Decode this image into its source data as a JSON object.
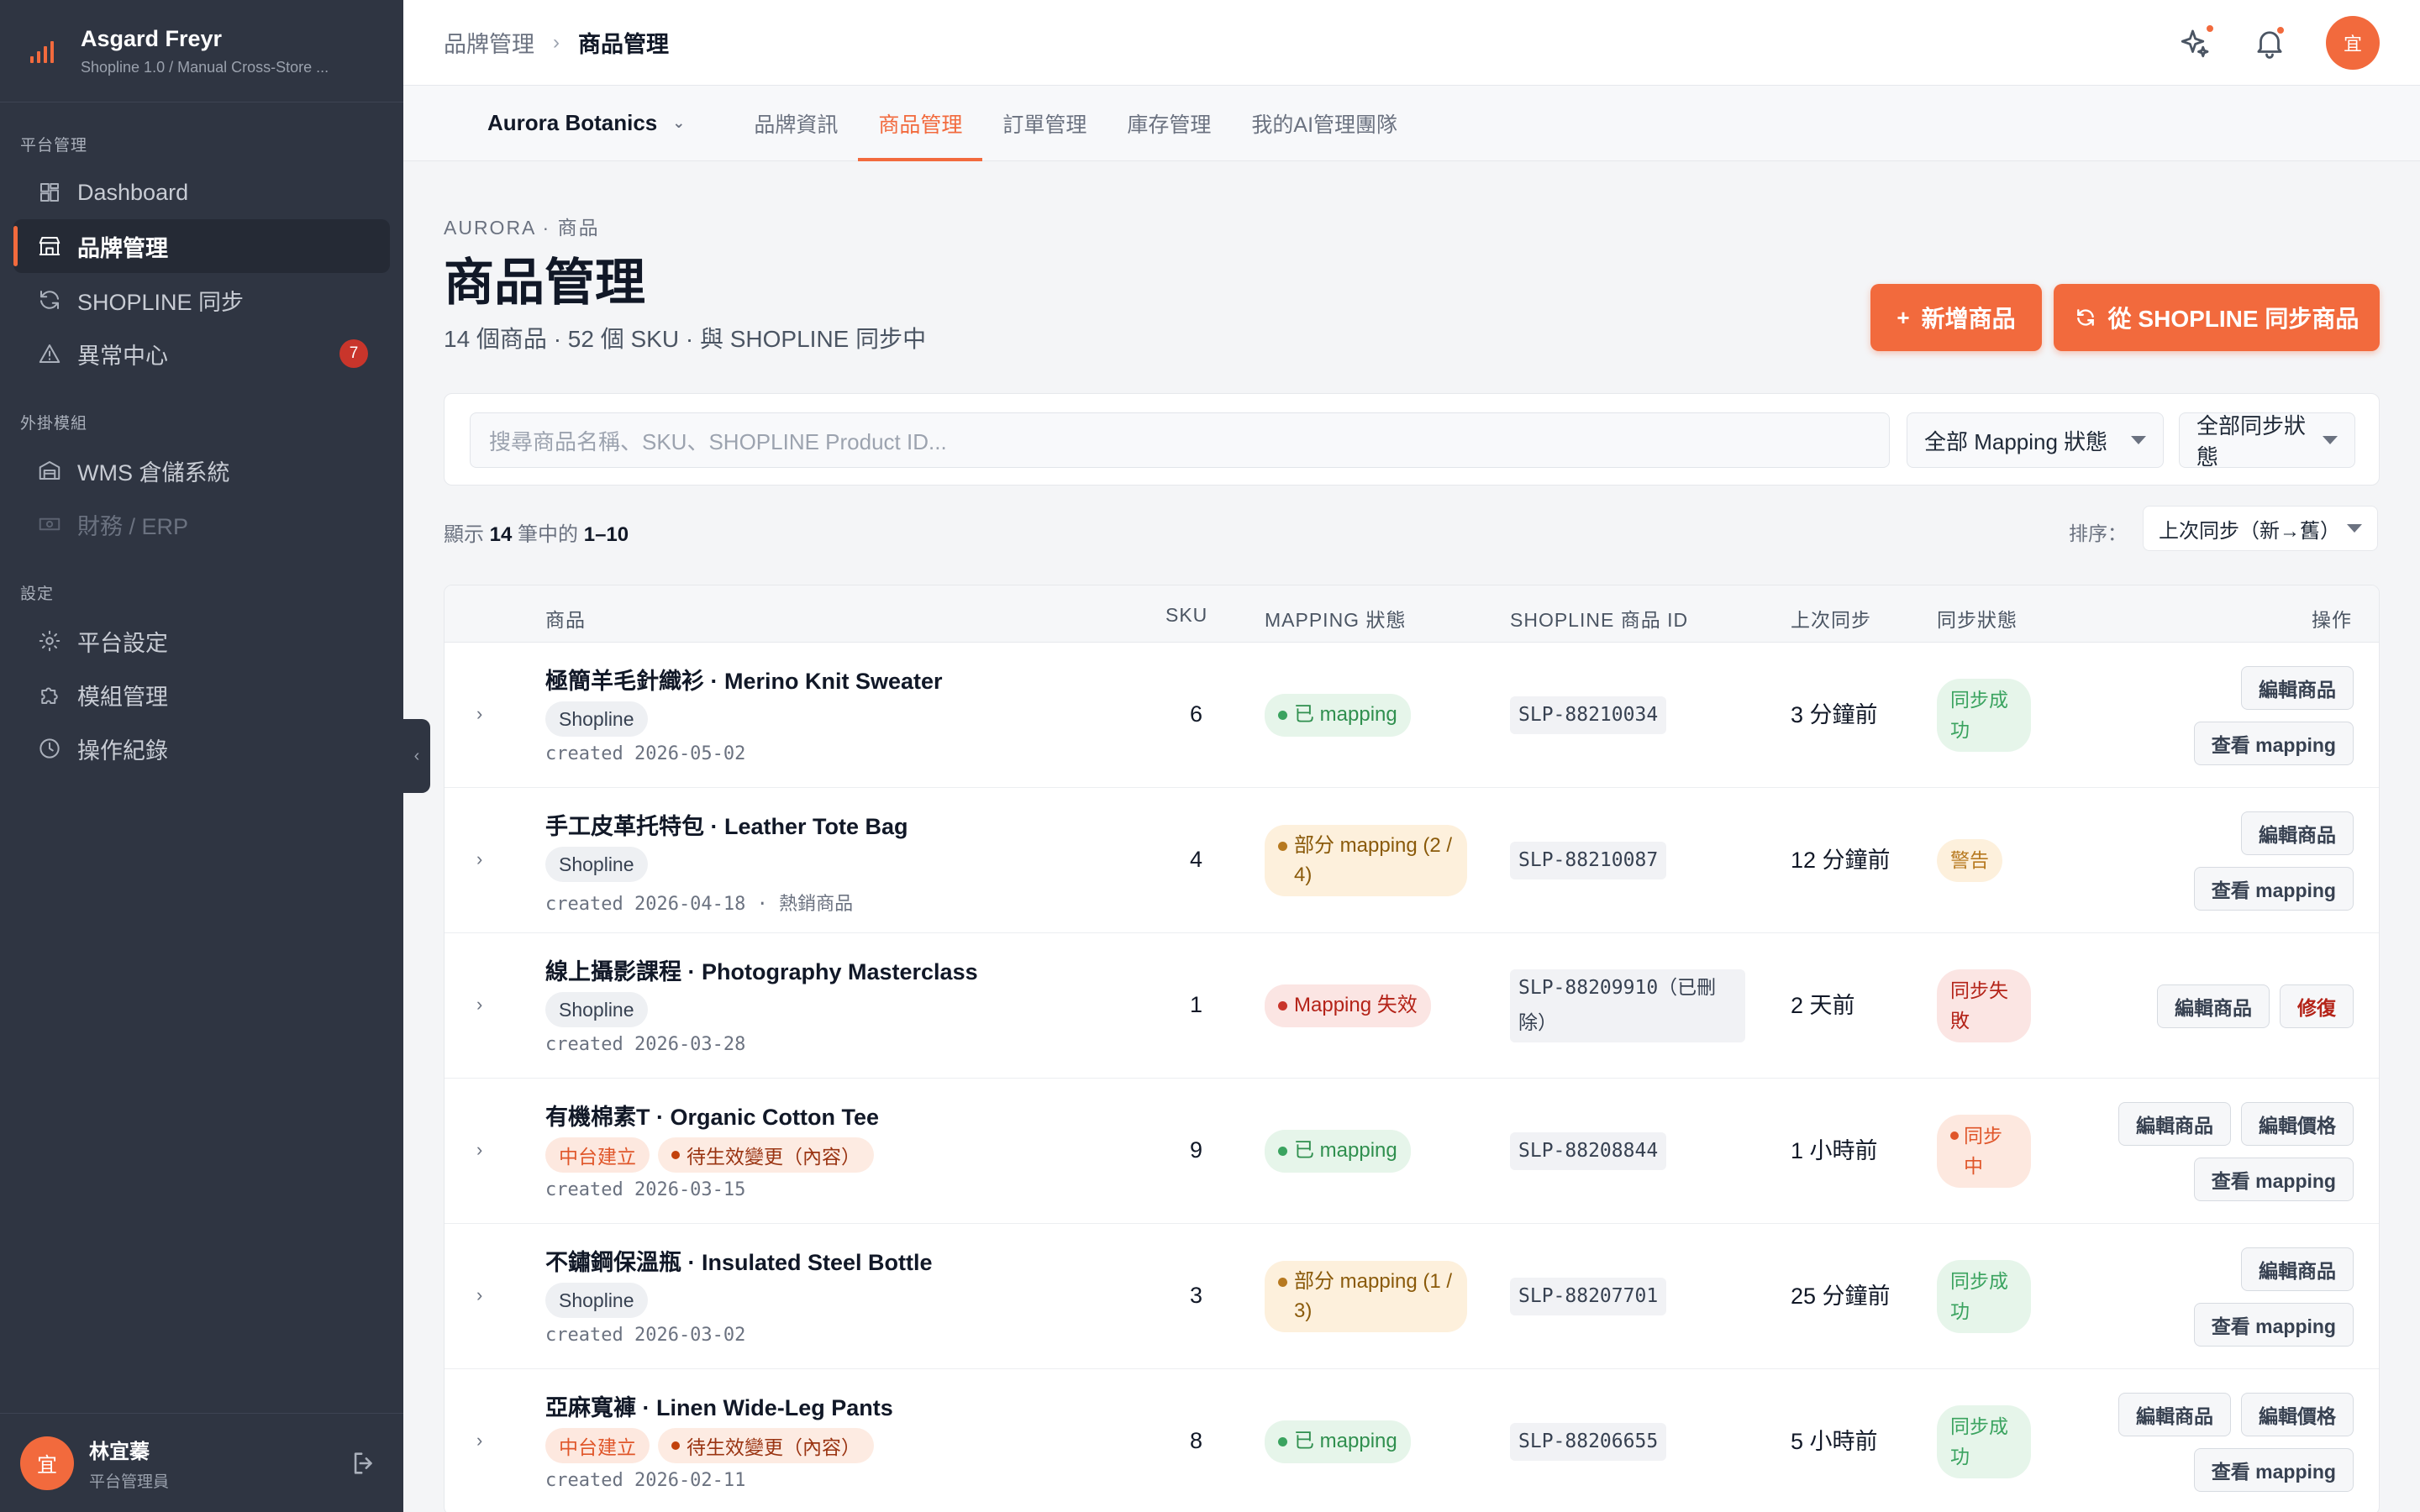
{
  "sidebar": {
    "app_name": "Asgard Freyr",
    "app_sub": "Shopline 1.0 / Manual Cross-Store ...",
    "sections": [
      {
        "title": "平台管理",
        "items": [
          {
            "label": "Dashboard",
            "icon": "dashboard-icon"
          },
          {
            "label": "品牌管理",
            "icon": "store-icon",
            "active": true
          },
          {
            "label": "SHOPLINE 同步",
            "icon": "sync-icon"
          },
          {
            "label": "異常中心",
            "icon": "warning-icon",
            "badge": "7"
          }
        ]
      },
      {
        "title": "外掛模組",
        "items": [
          {
            "label": "WMS 倉儲系統",
            "icon": "warehouse-icon"
          },
          {
            "label": "財務 / ERP",
            "icon": "money-icon",
            "disabled": true
          }
        ]
      },
      {
        "title": "設定",
        "items": [
          {
            "label": "平台設定",
            "icon": "gear-icon"
          },
          {
            "label": "模組管理",
            "icon": "puzzle-icon"
          },
          {
            "label": "操作紀錄",
            "icon": "clock-icon"
          }
        ]
      }
    ],
    "user": {
      "avatar": "宜",
      "name": "林宜蓁",
      "role": "平台管理員"
    },
    "collapse_glyph": "‹"
  },
  "topbar": {
    "breadcrumb": [
      "品牌管理",
      "商品管理"
    ],
    "avatar": "宜"
  },
  "tabs": {
    "brand": "Aurora Botanics",
    "items": [
      "品牌資訊",
      "商品管理",
      "訂單管理",
      "庫存管理",
      "我的AI管理團隊"
    ],
    "active": "商品管理"
  },
  "header": {
    "eyebrow": "AURORA · 商品",
    "title": "商品管理",
    "subtitle": "14 個商品 · 52 個 SKU · 與 SHOPLINE 同步中",
    "add_button": "新增商品",
    "sync_button": "從 SHOPLINE 同步商品"
  },
  "filters": {
    "search_placeholder": "搜尋商品名稱、SKU、SHOPLINE Product ID...",
    "mapping_filter": "全部 Mapping 狀態",
    "sync_filter": "全部同步狀態"
  },
  "listing": {
    "prefix": "顯示",
    "total": "14",
    "middle": "筆中的",
    "range": "1–10",
    "sort_label": "排序：",
    "sort_value": "上次同步（新→舊）"
  },
  "table": {
    "columns": [
      "商品",
      "SKU",
      "MAPPING 狀態",
      "SHOPLINE 商品 ID",
      "上次同步",
      "同步狀態",
      "操作"
    ],
    "rows": [
      {
        "name": "極簡羊毛針織衫 · Merino Knit Sweater",
        "tags": [
          {
            "type": "shop",
            "text": "Shopline"
          }
        ],
        "created": "created 2026-05-02",
        "sku": "6",
        "mapping": {
          "type": "ok",
          "text": "已 mapping"
        },
        "slp": "SLP-88210034",
        "last_sync": "3 分鐘前",
        "sync": {
          "type": "ok",
          "text": "同步成功"
        },
        "actions": [
          [
            "編輯商品"
          ],
          [
            "查看 mapping"
          ]
        ]
      },
      {
        "name": "手工皮革托特包 · Leather Tote Bag",
        "tags": [
          {
            "type": "shop",
            "text": "Shopline"
          }
        ],
        "created": "created 2026-04-18 · 熱銷商品",
        "sku": "4",
        "mapping": {
          "type": "part",
          "text": "部分 mapping (2 / 4)"
        },
        "slp": "SLP-88210087",
        "last_sync": "12 分鐘前",
        "sync": {
          "type": "warn",
          "text": "警告"
        },
        "actions": [
          [
            "編輯商品"
          ],
          [
            "查看 mapping"
          ]
        ]
      },
      {
        "name": "線上攝影課程 · Photography Masterclass",
        "tags": [
          {
            "type": "shop",
            "text": "Shopline"
          }
        ],
        "created": "created 2026-03-28",
        "sku": "1",
        "mapping": {
          "type": "fail",
          "text": "Mapping 失效"
        },
        "slp": "SLP-88209910（已刪除）",
        "last_sync": "2 天前",
        "sync": {
          "type": "fail",
          "text": "同步失敗"
        },
        "actions": [
          [
            "編輯商品",
            "修復"
          ]
        ]
      },
      {
        "name": "有機棉素T · Organic Cotton Tee",
        "tags": [
          {
            "type": "mid",
            "text": "中台建立"
          },
          {
            "type": "pend",
            "text": "待生效變更（內容）"
          }
        ],
        "created": "created 2026-03-15",
        "sku": "9",
        "mapping": {
          "type": "ok",
          "text": "已 mapping"
        },
        "slp": "SLP-88208844",
        "last_sync": "1 小時前",
        "sync": {
          "type": "run",
          "text": "同步中"
        },
        "actions": [
          [
            "編輯商品",
            "編輯價格"
          ],
          [
            "查看 mapping"
          ]
        ]
      },
      {
        "name": "不鏽鋼保溫瓶 · Insulated Steel Bottle",
        "tags": [
          {
            "type": "shop",
            "text": "Shopline"
          }
        ],
        "created": "created 2026-03-02",
        "sku": "3",
        "mapping": {
          "type": "part",
          "text": "部分 mapping (1 / 3)"
        },
        "slp": "SLP-88207701",
        "last_sync": "25 分鐘前",
        "sync": {
          "type": "ok",
          "text": "同步成功"
        },
        "actions": [
          [
            "編輯商品"
          ],
          [
            "查看 mapping"
          ]
        ]
      },
      {
        "name": "亞麻寬褲 · Linen Wide-Leg Pants",
        "tags": [
          {
            "type": "mid",
            "text": "中台建立"
          },
          {
            "type": "pend",
            "text": "待生效變更（內容）"
          }
        ],
        "created": "created 2026-02-11",
        "sku": "8",
        "mapping": {
          "type": "ok",
          "text": "已 mapping"
        },
        "slp": "SLP-88206655",
        "last_sync": "5 小時前",
        "sync": {
          "type": "ok",
          "text": "同步成功"
        },
        "actions": [
          [
            "編輯商品",
            "編輯價格"
          ],
          [
            "查看 mapping"
          ]
        ]
      }
    ]
  },
  "colors": {
    "accent": "#f26a3d",
    "sidebar_bg": "#2f3542",
    "success": "#3aa35f",
    "danger": "#c9352b",
    "warning": "#b7791f"
  }
}
